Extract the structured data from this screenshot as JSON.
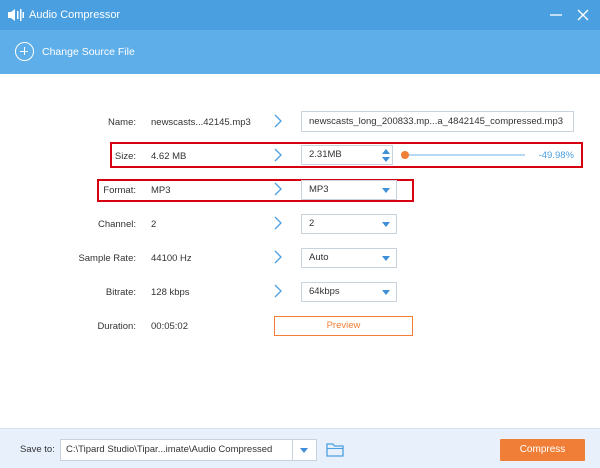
{
  "window": {
    "title": "Audio Compressor",
    "accent_color": "#4a9fe0",
    "action_color": "#f07e36"
  },
  "toolbar": {
    "change_source_label": "Change Source File"
  },
  "form": {
    "name": {
      "label": "Name:",
      "source": "newscasts...42145.mp3",
      "output": "newscasts_long_200833.mp...a_4842145_compressed.mp3"
    },
    "size": {
      "label": "Size:",
      "source": "4.62 MB",
      "output": "2.31MB",
      "percent": "-49.98%",
      "slider_fraction": 0.0
    },
    "format": {
      "label": "Format:",
      "source": "MP3",
      "output": "MP3"
    },
    "channel": {
      "label": "Channel:",
      "source": "2",
      "output": "2"
    },
    "sample_rate": {
      "label": "Sample Rate:",
      "source": "44100 Hz",
      "output": "Auto"
    },
    "bitrate": {
      "label": "Bitrate:",
      "source": "128 kbps",
      "output": "64kbps"
    },
    "duration": {
      "label": "Duration:",
      "source": "00:05:02"
    },
    "preview_label": "Preview"
  },
  "footer": {
    "save_to_label": "Save to:",
    "save_path": "C:\\Tipard Studio\\Tipar...imate\\Audio Compressed",
    "compress_label": "Compress"
  },
  "icons": {
    "app": "audio-compress-icon",
    "minimize": "minimize-icon",
    "close": "close-icon",
    "add": "plus-circle-icon",
    "arrow": "chevron-right-icon",
    "folder": "folder-icon"
  }
}
